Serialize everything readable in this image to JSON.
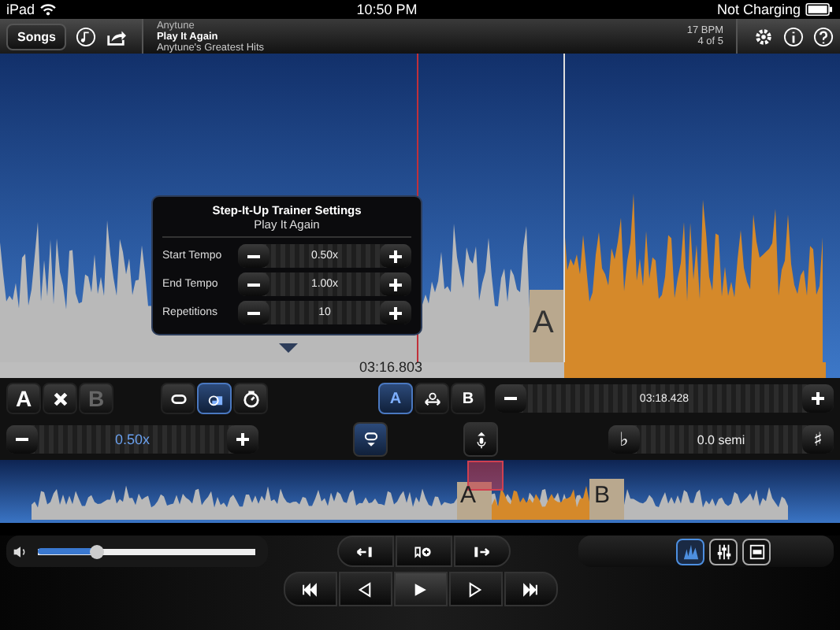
{
  "status_bar": {
    "device": "iPad",
    "time": "10:50 PM",
    "battery": "Not Charging"
  },
  "toolbar": {
    "songs_button": "Songs",
    "artist": "Anytune",
    "title": "Play It Again",
    "album": "Anytune's Greatest Hits",
    "bpm": "17 BPM",
    "position": "4 of 5"
  },
  "waveform": {
    "time": "03:16.803",
    "marker": "A"
  },
  "trainer_popup": {
    "title": "Step-It-Up Trainer Settings",
    "subtitle": "Play It Again",
    "rows": [
      {
        "label": "Start Tempo",
        "value": "0.50x"
      },
      {
        "label": "End Tempo",
        "value": "1.00x"
      },
      {
        "label": "Repetitions",
        "value": "10"
      }
    ]
  },
  "ab_buttons": [
    {
      "kind": "letter",
      "label": "A",
      "disabled": false
    },
    {
      "kind": "clear",
      "disabled": false
    },
    {
      "kind": "letter",
      "label": "B",
      "disabled": true
    }
  ],
  "loop_modes": [
    {
      "kind": "loop",
      "selected": false
    },
    {
      "kind": "step",
      "selected": true
    },
    {
      "kind": "timer",
      "selected": false
    }
  ],
  "marker_modes": [
    {
      "kind": "set",
      "label": "A",
      "selected": true
    },
    {
      "kind": "span",
      "selected": false
    },
    {
      "kind": "set",
      "label": "B",
      "selected": false
    }
  ],
  "position_stepper": {
    "value": "03:18.428"
  },
  "tempo_stepper": {
    "value": "0.50x"
  },
  "pitch": {
    "flat": "♭",
    "value": "0.0 semi",
    "sharp": "♯"
  },
  "mini_waveform": {
    "markers": [
      "A",
      "B"
    ]
  },
  "volume": {
    "level": 0.27
  },
  "view_buttons": [
    {
      "kind": "spectrum",
      "selected": true
    },
    {
      "kind": "mixer",
      "selected": false
    },
    {
      "kind": "screen",
      "selected": false
    }
  ]
}
